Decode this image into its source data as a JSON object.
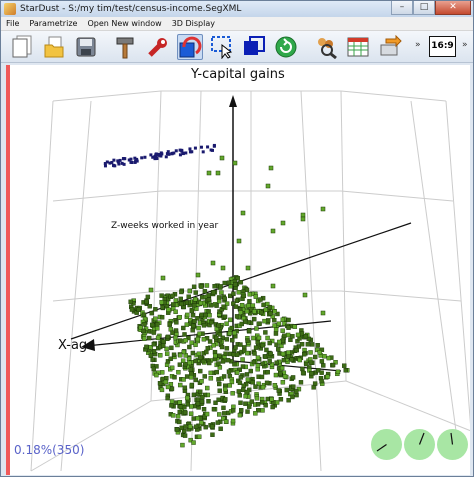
{
  "window": {
    "title": "StarDust - S:/my tim/test/census-income.SegXML",
    "buttons": {
      "minimize": "–",
      "maximize": "□",
      "close": "✕"
    }
  },
  "menu": [
    "File",
    "Parametrize",
    "Open New window",
    "3D Display"
  ],
  "toolbar": {
    "tools": [
      "new-document-icon",
      "open-folder-icon",
      "save-disk-icon",
      "hammer-icon",
      "wrench-icon",
      "rotate-tool-icon",
      "select-pointer-icon",
      "zoom-region-icon",
      "refresh-green-icon",
      "people-magnifier-icon",
      "grid-table-icon",
      "export-arrow-icon"
    ],
    "chevron": "»",
    "aspect_label": "16:9"
  },
  "plot": {
    "axis_y": "Y-capital gains",
    "axis_x": "X-age",
    "axis_z": "Z-weeks worked in year",
    "status": "0.18%(350)",
    "accent": {
      "points": "#3d6b16",
      "points_hi": "#62a82c",
      "top_cluster": "#1a1a6e",
      "grid": "#cccccc"
    }
  }
}
